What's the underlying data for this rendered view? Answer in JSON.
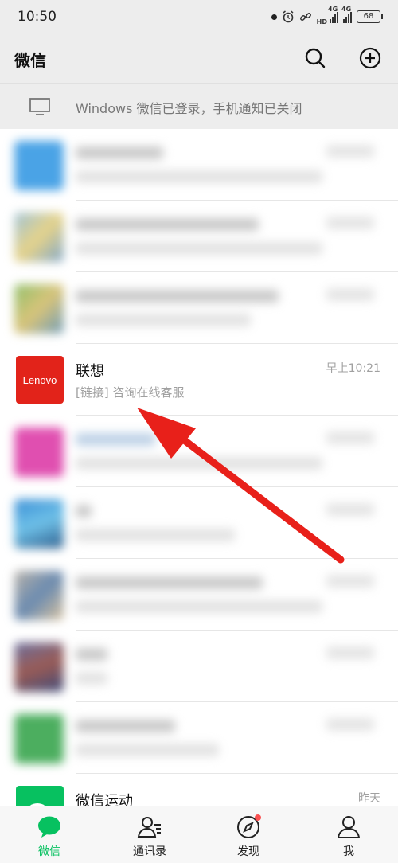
{
  "status_bar": {
    "time": "10:50",
    "hd_label": "HD",
    "net1": "4G",
    "net2": "4G",
    "battery": "68"
  },
  "header": {
    "title": "微信",
    "search_icon": "search-icon",
    "add_icon": "plus-circle-icon"
  },
  "notice": {
    "text": "Windows 微信已登录，手机通知已关闭",
    "icon": "monitor-icon"
  },
  "chats": [
    {
      "name": "联想",
      "message": "[链接] 咨询在线客服",
      "time": "早上10:21",
      "avatar_text": "Lenovo",
      "avatar_color": "#e2231a"
    },
    {
      "name": "微信运动",
      "message": "",
      "time": "昨天",
      "avatar_color": "#07c160"
    }
  ],
  "tabs": [
    {
      "label": "微信",
      "icon": "chat-bubble-icon"
    },
    {
      "label": "通讯录",
      "icon": "contacts-icon"
    },
    {
      "label": "发现",
      "icon": "compass-icon"
    },
    {
      "label": "我",
      "icon": "person-icon"
    }
  ],
  "colors": {
    "accent": "#07c160",
    "badge": "#fa5151",
    "arrow": "#e8201a"
  }
}
